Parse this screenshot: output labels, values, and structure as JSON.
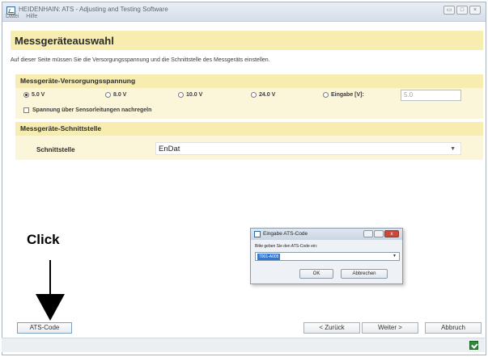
{
  "window": {
    "title": "HEIDENHAIN: ATS - Adjusting and Testing Software",
    "menu": [
      "Datei",
      "Hilfe"
    ]
  },
  "page": {
    "title": "Messgeräteauswahl",
    "description": "Auf dieser Seite müssen Sie die Versorgungsspannung und die Schnittstelle des Messgeräts einstellen."
  },
  "supply": {
    "section_label": "Messgeräte-Versorgungsspannung",
    "options": [
      {
        "label": "5.0 V",
        "selected": true
      },
      {
        "label": "8.0 V",
        "selected": false
      },
      {
        "label": "10.0 V",
        "selected": false
      },
      {
        "label": "24.0 V",
        "selected": false
      },
      {
        "label": "Eingabe [V]:",
        "selected": false
      }
    ],
    "custom_value": "5.0",
    "sense_checkbox_label": "Spannung über Sensorleitungen nachregeln",
    "sense_checked": false
  },
  "interface": {
    "section_label": "Messgeräte-Schnittstelle",
    "field_label": "Schnittstelle",
    "selected_value": "EnDat"
  },
  "annotation": {
    "label": "Click"
  },
  "dialog": {
    "title": "Eingabe ATS-Code",
    "prompt": "Bitte geben Sie den ATS-Code ein:",
    "code_value": "7001-A005",
    "ok_label": "OK",
    "cancel_label": "Abbrechen"
  },
  "footer": {
    "ats_code_label": "ATS-Code",
    "back_label": "< Zurück",
    "next_label": "Weiter >",
    "cancel_label": "Abbruch"
  },
  "colors": {
    "section_bg": "#f8edb0",
    "panel_bg": "#fbf6d9",
    "status_icon": "#2e8b3a"
  }
}
